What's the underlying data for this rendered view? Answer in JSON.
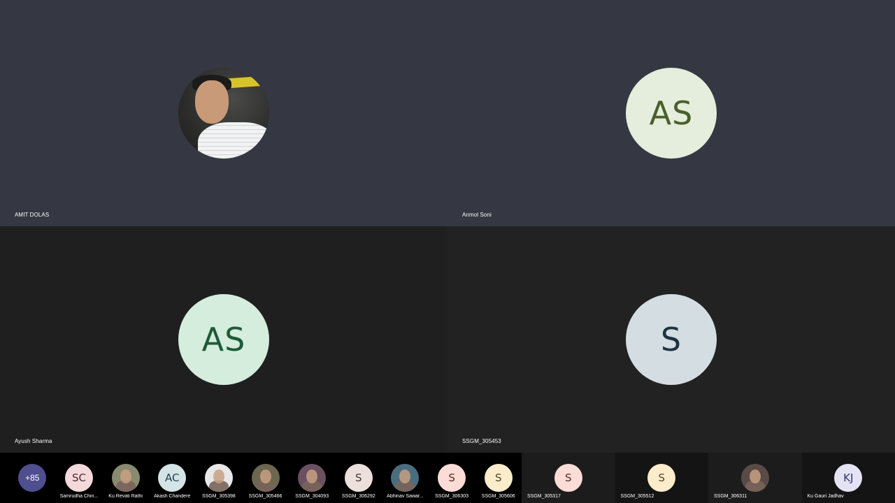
{
  "tiles": [
    {
      "name": "AMIT DOLAS",
      "initials": "",
      "avatar_type": "photo",
      "avatar_bg": "#3a3a3a",
      "avatar_fg": "#000000"
    },
    {
      "name": "Anmol Soni",
      "initials": "AS",
      "avatar_type": "initials",
      "avatar_bg": "#e5eddc",
      "avatar_fg": "#4a5f2a"
    },
    {
      "name": "Ayush Sharma",
      "initials": "AS",
      "avatar_type": "initials",
      "avatar_bg": "#d4eddc",
      "avatar_fg": "#1f5a38"
    },
    {
      "name": "SSGM_305453",
      "initials": "S",
      "avatar_type": "initials",
      "avatar_bg": "#d3dde2",
      "avatar_fg": "#1d3440"
    }
  ],
  "overflow": {
    "label": "+85",
    "bg": "#4f4f8f"
  },
  "strip": [
    {
      "name": "Samrudha Chin...",
      "initials": "SC",
      "bg": "#f3d9dc",
      "fg": "#4a2a30",
      "photo": false
    },
    {
      "name": "Ku Revati Rathi",
      "initials": "",
      "bg": "#8a8a70",
      "fg": "#000000",
      "photo": true
    },
    {
      "name": "Akash Chandere",
      "initials": "AC",
      "bg": "#d3e3e6",
      "fg": "#24434a",
      "photo": false
    },
    {
      "name": "SSGM_305398",
      "initials": "",
      "bg": "#e8e8e8",
      "fg": "#000000",
      "photo": true
    },
    {
      "name": "SSGM_305466",
      "initials": "",
      "bg": "#6d6650",
      "fg": "#000000",
      "photo": true
    },
    {
      "name": "SSGM_304093",
      "initials": "",
      "bg": "#6a5060",
      "fg": "#000000",
      "photo": true
    },
    {
      "name": "SSGM_306292",
      "initials": "S",
      "bg": "#ebe0dc",
      "fg": "#4a3a30",
      "photo": false
    },
    {
      "name": "Abhinav Sawar...",
      "initials": "",
      "bg": "#4a6e80",
      "fg": "#000000",
      "photo": true
    },
    {
      "name": "SSGM_306303",
      "initials": "S",
      "bg": "#fbdcd6",
      "fg": "#5a2a20",
      "photo": false
    },
    {
      "name": "SSGM_305606",
      "initials": "S",
      "bg": "#fbeccb",
      "fg": "#5a4520",
      "photo": false
    }
  ],
  "strip_tiles": [
    {
      "name": "SSGM_305317",
      "initials": "S",
      "bg": "#fbdcd6",
      "fg": "#5a2a20",
      "photo": false
    },
    {
      "name": "SSGM_305512",
      "initials": "S",
      "bg": "#fbeccb",
      "fg": "#5a4520",
      "photo": false
    },
    {
      "name": "SSGM_306311",
      "initials": "",
      "bg": "#5a4a48",
      "fg": "#000000",
      "photo": true
    },
    {
      "name": "Ku Gauri Jadhav",
      "initials": "KJ",
      "bg": "#e3e3f3",
      "fg": "#33336a",
      "photo": false
    }
  ]
}
